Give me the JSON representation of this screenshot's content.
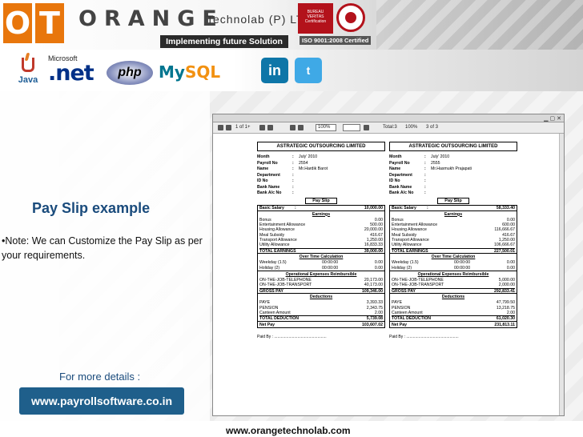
{
  "header": {
    "logo_o": "O",
    "logo_t": "T",
    "brand": "ORANGE",
    "brand_sub": "Technolab (P) LTD",
    "tagline": "Implementing future Solution",
    "bv_badge": "BUREAU VERITAS Certification",
    "iso": "ISO 9001:2008 Certified"
  },
  "tech_logos": {
    "java": "Java",
    "ms": "Microsoft",
    "net": ".net",
    "php": "php",
    "mysql_my": "My",
    "mysql_sql": "SQL",
    "linkedin": "in",
    "twitter": "t"
  },
  "content": {
    "title": "Pay Slip example",
    "note": "•Note: We can Customize the Pay Slip as per your requirements.",
    "more_details": "For more details :",
    "url_button": "www.payrollsoftware.co.in",
    "footer_url": "www.orangetechnolab.com"
  },
  "viewer": {
    "page_nav": "1 of 1+",
    "zoom": "100%",
    "total": "Total:3",
    "percent": "100%",
    "pages": "3 of 3"
  },
  "payslips": [
    {
      "company": "ASTRATEGIC OUTSOURCING LIMITED",
      "info": [
        {
          "k": "Month",
          "v": "July' 2010"
        },
        {
          "k": "Payroll No",
          "v": "2554"
        },
        {
          "k": "Name",
          "v": "Mr.Hardik Barot"
        },
        {
          "k": "Department",
          "v": ""
        },
        {
          "k": "ID No",
          "v": ""
        },
        {
          "k": "Bank Name",
          "v": ""
        },
        {
          "k": "Bank A/c No",
          "v": ""
        }
      ],
      "pay_slip_label": "Pay Slip",
      "basic_label": "Basic Salary",
      "basic": "10,000.00",
      "earnings_h": "Earnings",
      "earnings": [
        {
          "k": "Bonus",
          "v": "0.00"
        },
        {
          "k": "Entertainment Allowance",
          "v": "500.00"
        },
        {
          "k": "Housing Allowance",
          "v": "20,000.00"
        },
        {
          "k": "Meal Subsidy",
          "v": "416.67"
        },
        {
          "k": "Transport Allowance",
          "v": "1,250.00"
        },
        {
          "k": "Utility Allowance",
          "v": "16,833.33"
        }
      ],
      "total_earnings_label": "TOTAL EARNINGS",
      "total_earnings": "39,000.00",
      "ot_h": "Over Time Calculation",
      "ot": [
        {
          "k": "Weekday (1.5)",
          "m": "00:00:00",
          "v": "0.00"
        },
        {
          "k": "Holiday (2)",
          "m": "00:00:00",
          "v": "0.00"
        }
      ],
      "reimb_h": "Operational Expenses Reimbursible",
      "reimb": [
        {
          "k": "ON-THE-JOB-TELEPHONE",
          "v": "20,173.00"
        },
        {
          "k": "ON-THE-JOB-TRANSPORT",
          "v": "40,173.00"
        }
      ],
      "gross_label": "GROSS PAY",
      "gross": "109,346.00",
      "ded_h": "Deductions",
      "deductions": [
        {
          "k": "PAYE",
          "v": "3,393.33"
        },
        {
          "k": "PENSION",
          "v": "2,343.75"
        },
        {
          "k": "Canteen Amount",
          "v": "2.00"
        }
      ],
      "total_ded_label": "TOTAL DEDUCTION",
      "total_ded": "5,739.08",
      "net_label": "Net Pay",
      "net": "103,607.02",
      "paid_by": "Paid By : ..............................................."
    },
    {
      "company": "ASTRATEGIC OUTSOURCING LIMITED",
      "info": [
        {
          "k": "Month",
          "v": "July' 2010"
        },
        {
          "k": "Payroll No",
          "v": "2555"
        },
        {
          "k": "Name",
          "v": "Mr.Hasmukh Prajapati"
        },
        {
          "k": "Department",
          "v": ""
        },
        {
          "k": "ID No",
          "v": ""
        },
        {
          "k": "Bank Name",
          "v": ""
        },
        {
          "k": "Bank A/c No",
          "v": ""
        }
      ],
      "pay_slip_label": "Pay Slip",
      "basic_label": "Basic Salary",
      "basic": "58,333.40",
      "earnings_h": "Earnings",
      "earnings": [
        {
          "k": "Bonus",
          "v": "0.00"
        },
        {
          "k": "Entertainment Allowance",
          "v": "600.00"
        },
        {
          "k": "Housing Allowance",
          "v": "116,666.67"
        },
        {
          "k": "Meal Subsidy",
          "v": "416.67"
        },
        {
          "k": "Transport Allowance",
          "v": "1,250.00"
        },
        {
          "k": "Utility Allowance",
          "v": "106,666.67"
        }
      ],
      "total_earnings_label": "TOTAL EARNINGS",
      "total_earnings": "227,500.01",
      "ot_h": "Over Time Calculation",
      "ot": [
        {
          "k": "Weekday (1.5)",
          "m": "00:00:00",
          "v": "0.00"
        },
        {
          "k": "Holiday (2)",
          "m": "00:00:00",
          "v": "0.00"
        }
      ],
      "reimb_h": "Operational Expenses Reimbursible",
      "reimb": [
        {
          "k": "ON-THE-JOB-TELEPHONE",
          "v": "5,000.00"
        },
        {
          "k": "ON-THE-JOB-TRANSPORT",
          "v": "2,000.00"
        }
      ],
      "gross_label": "GROSS PAY",
      "gross": "292,833.41",
      "ded_h": "Deductions",
      "deductions": [
        {
          "k": "PAYE",
          "v": "47,799.50"
        },
        {
          "k": "PENSION",
          "v": "13,218.75"
        },
        {
          "k": "Canteen Amount",
          "v": "2.00"
        }
      ],
      "total_ded_label": "TOTAL DEDUCTION",
      "total_ded": "61,020.30",
      "net_label": "Net Pay",
      "net": "231,813.11",
      "paid_by": "Paid By : ..............................................."
    }
  ],
  "colors": {
    "brand_orange": "#e8760c",
    "title_blue": "#1a4b7c",
    "button_blue": "#1f5f8b"
  }
}
